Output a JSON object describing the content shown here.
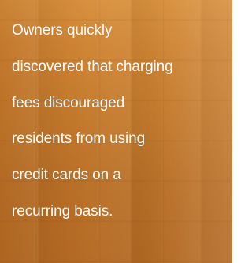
{
  "quote": {
    "lines": [
      "Owners quickly",
      "discovered that charging",
      "fees discouraged",
      "residents from using",
      "credit cards on a",
      "recurring basis."
    ]
  }
}
